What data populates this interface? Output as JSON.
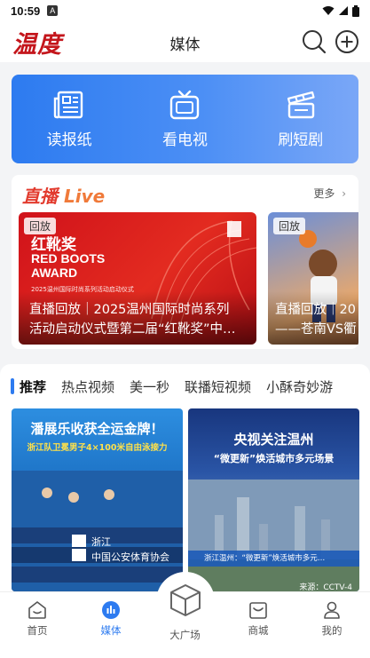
{
  "status_bar": {
    "time": "10:59",
    "notification_glyph": "A"
  },
  "header": {
    "logo_text": "温度",
    "title": "媒体"
  },
  "quick_links": [
    {
      "label": "读报纸",
      "icon": "newspaper-icon"
    },
    {
      "label": "看电视",
      "icon": "tv-icon"
    },
    {
      "label": "刷短剧",
      "icon": "clapperboard-icon"
    }
  ],
  "live": {
    "logo_cn": "直播",
    "logo_en": "Live",
    "more": "更多",
    "cards": [
      {
        "badge": "回放",
        "title": "直播回放｜2025温州国际时尚系列\n活动启动仪式暨第二届“红靴奖”中…",
        "poster_cn": "红靴奖",
        "poster_en_1": "RED BOOTS",
        "poster_en_2": "AWARD",
        "poster_sub": "2025温州国际时尚系列活动启动仪式"
      },
      {
        "badge": "回放",
        "title": "直播回放｜20\n——苍南VS衢"
      }
    ]
  },
  "tabs": [
    "推荐",
    "热点视频",
    "美一秒",
    "联播短视频",
    "小酥奇妙游"
  ],
  "videos": [
    {
      "headline": "潘展乐收获全运金牌！",
      "subline": "浙江队卫冕男子4×100米自由泳接力",
      "lane_text_1": "浙江",
      "lane_text_2": "中国公安体育协会"
    },
    {
      "headline": "央视关注温州",
      "subline": "“微更新”焕活城市多元场景",
      "caption": "浙江温州：“微更新”焕活城市多元…",
      "source": "来源：CCTV-4"
    }
  ],
  "bottom_nav": {
    "items": [
      {
        "label": "首页",
        "icon": "home-icon"
      },
      {
        "label": "媒体",
        "icon": "media-icon"
      },
      {
        "label": "大广场",
        "icon": "cube-icon"
      },
      {
        "label": "商城",
        "icon": "shop-icon"
      },
      {
        "label": "我的",
        "icon": "profile-icon"
      }
    ]
  },
  "colors": {
    "accent": "#2d7bf0",
    "brand_red": "#c4161c"
  }
}
